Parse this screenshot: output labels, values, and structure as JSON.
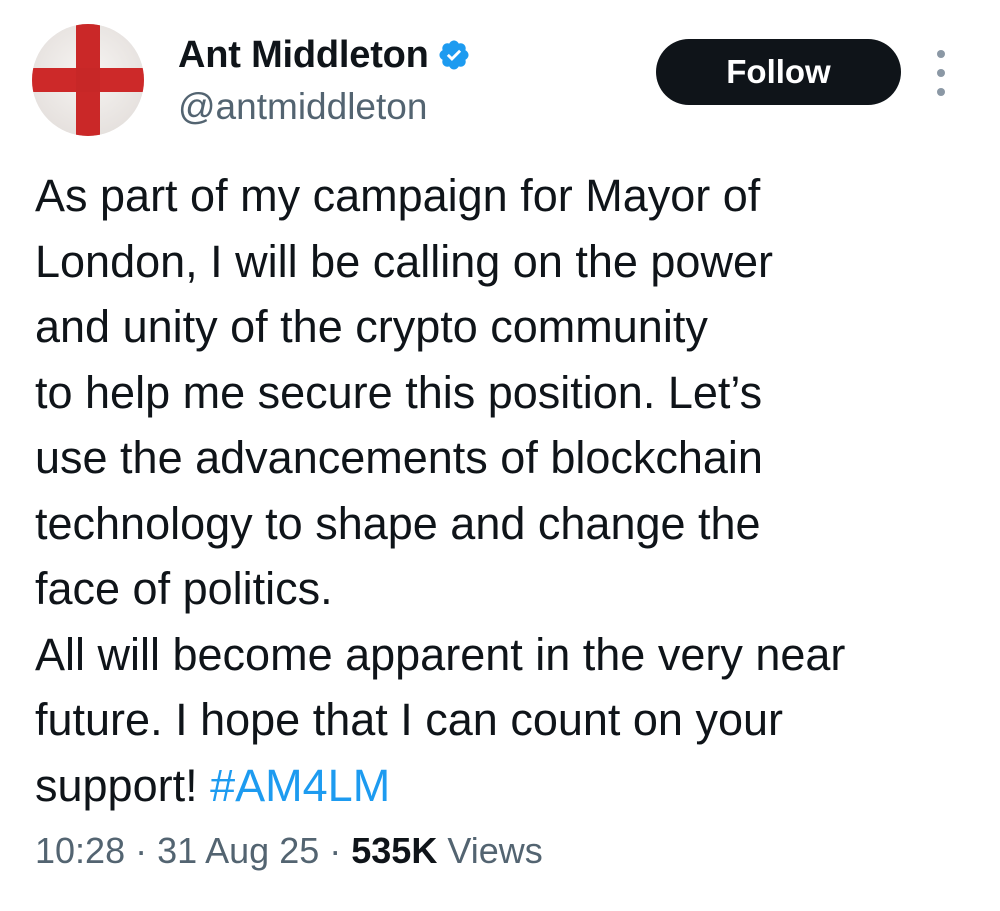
{
  "user": {
    "display_name": "Ant Middleton",
    "handle": "@antmiddleton",
    "verified": true,
    "avatar": "st-george-cross-flag"
  },
  "actions": {
    "follow_label": "Follow",
    "more_icon": "more-vertical-icon"
  },
  "tweet": {
    "text": "As part of my campaign for Mayor of\nLondon, I will be calling on the power\nand unity of the crypto community\nto help me secure this position. Let’s\nuse the advancements of blockchain\ntechnology to shape and change the\nface of politics.\nAll will become apparent in the very near\nfuture. I hope that I can count on your\nsupport! ",
    "hashtag": "#AM4LM"
  },
  "meta": {
    "time": "10:28",
    "separator": "·",
    "date": "31 Aug 25",
    "views_count": "535K",
    "views_label": "Views"
  },
  "colors": {
    "text": "#0f1419",
    "secondary": "#536471",
    "link": "#1d9bf0",
    "verified": "#1d9bf0",
    "button_bg": "#0f1419",
    "flag_red": "#d22b2b"
  }
}
